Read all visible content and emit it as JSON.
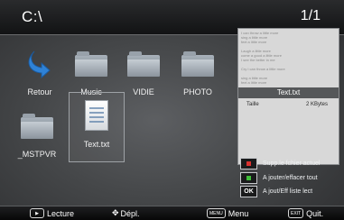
{
  "header": {
    "path": "C:\\",
    "page": "1/1"
  },
  "grid": {
    "items": [
      {
        "label": "Retour",
        "icon": "back-arrow-icon"
      },
      {
        "label": "Music",
        "icon": "folder-icon"
      },
      {
        "label": "VIDIE",
        "icon": "folder-icon"
      },
      {
        "label": "PHOTO",
        "icon": "folder-icon"
      },
      {
        "label": "_MSTPVR",
        "icon": "folder-icon"
      },
      {
        "label": "Text.txt",
        "icon": "text-file-icon",
        "selected": true
      }
    ]
  },
  "preview": {
    "text": "I can throw a little more\nsing a little more\nfeel a little more\n\nLaugh a little more\ncome a good a little more\nI see the better in me\n\nCry I can throw a little more\n\nsing a little more\nfeel a little more",
    "filename": "Text.txt",
    "size_label": "Taille",
    "size_value": "2 KBytes"
  },
  "legend": {
    "items": [
      {
        "key": "",
        "key_color": "#d9312f",
        "text": "Supp.le fchier actuel"
      },
      {
        "key": "",
        "key_color": "#3fbf3a",
        "text": "A jouter/effacer tout"
      },
      {
        "key": "OK",
        "key_color": "",
        "text": "A jout/Eff liste lect"
      }
    ]
  },
  "footer": {
    "play_label": "Lecture",
    "move_label": "Dépl.",
    "menu_key": "MENU",
    "menu_label": "Menu",
    "exit_key": "EXIT",
    "exit_label": "Quit."
  }
}
